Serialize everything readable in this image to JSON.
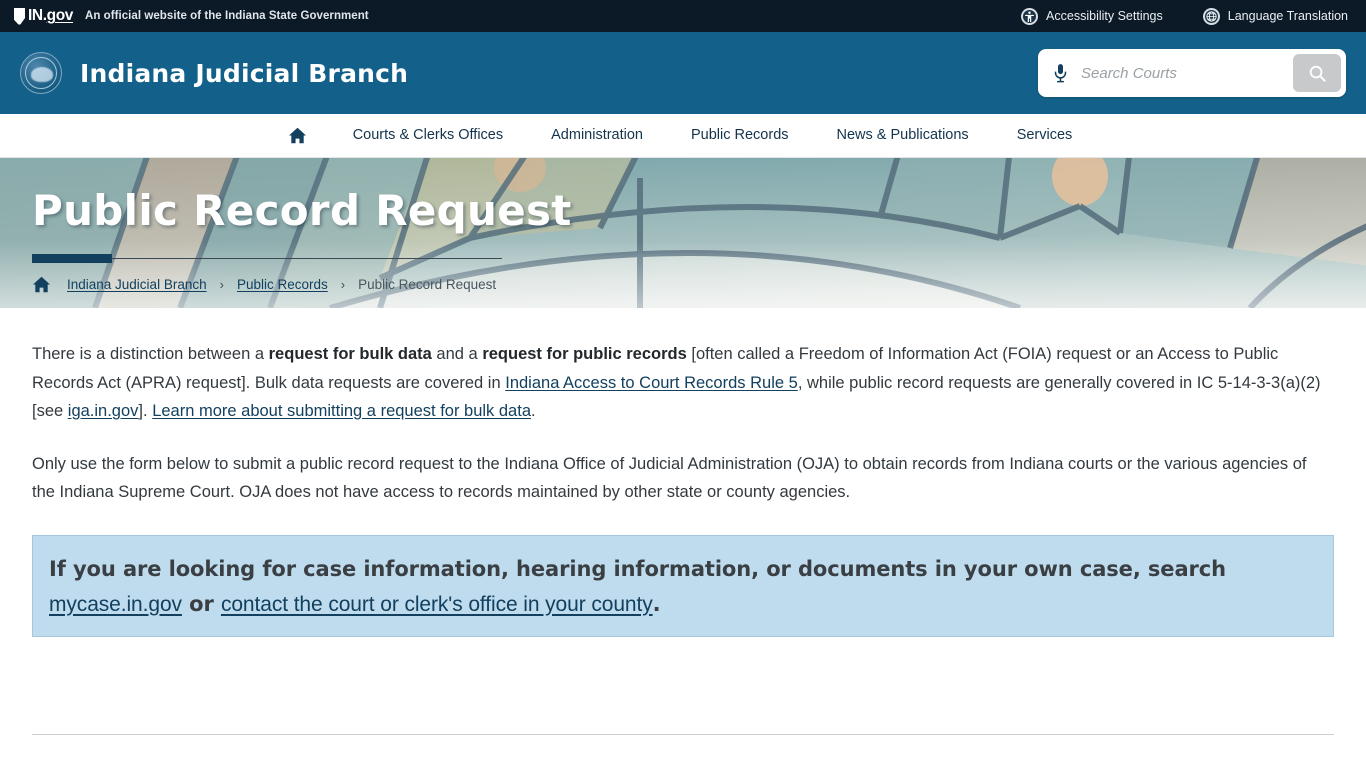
{
  "govbar": {
    "logo_text_in": "IN",
    "logo_text_dot": ".",
    "logo_text_gov": "gov",
    "tagline": "An official website of the Indiana State Government",
    "links": [
      {
        "label": "Accessibility Settings",
        "icon": "accessibility-icon"
      },
      {
        "label": "Language Translation",
        "icon": "globe-icon"
      }
    ]
  },
  "masthead": {
    "site_title": "Indiana Judicial Branch",
    "seal_alt": "indiana-judicial-seal",
    "search": {
      "placeholder": "Search Courts",
      "value": "",
      "mic_icon": "microphone-icon",
      "submit_icon": "search-icon"
    }
  },
  "nav": {
    "home_icon": "home-icon",
    "items": [
      {
        "label": "Courts & Clerks Offices"
      },
      {
        "label": "Administration"
      },
      {
        "label": "Public Records"
      },
      {
        "label": "News & Publications"
      },
      {
        "label": "Services"
      }
    ]
  },
  "hero": {
    "title": "Public Record Request",
    "background": "stained-glass-window",
    "breadcrumb": {
      "home_icon": "home-icon",
      "separator": "›",
      "items": [
        {
          "label": "Indiana Judicial Branch",
          "current": false
        },
        {
          "label": "Public Records",
          "current": false
        },
        {
          "label": "Public Record Request",
          "current": true
        }
      ]
    }
  },
  "content": {
    "paragraph1": {
      "t1": "There is a distinction between a ",
      "b1": "request for bulk data",
      "t2": " and a ",
      "b2": "request for public records",
      "t3": " [often called a Freedom of Information Act (FOIA) request or an Access to Public Records Act (APRA) request]. Bulk data requests are covered in ",
      "link1": "Indiana Access to Court Records Rule 5",
      "t4": ", while public record requests are generally covered in IC 5-14-3-3(a)(2) [see ",
      "link2": "iga.in.gov",
      "t5": "]. ",
      "link3": "Learn more about submitting a request for bulk data",
      "t6": "."
    },
    "paragraph2": "Only use the form below to submit a public record request to the Indiana Office of Judicial Administration (OJA) to obtain records from Indiana courts or the various agencies of the Indiana Supreme Court. OJA does not have access to records maintained by other state or county agencies.",
    "callout": {
      "t1": "If you are looking for case information, hearing information, or documents in your own case, search ",
      "link1": "mycase.in.gov",
      "t2": " or ",
      "link2": "contact the court or clerk's office in your county",
      "t3": "."
    }
  },
  "colors": {
    "govbar_bg": "#0c1a27",
    "header_bg": "#13618a",
    "accent_dark": "#12405e",
    "callout_bg": "#bfdcee",
    "callout_border": "#a4c8dd",
    "link": "#12405e",
    "body_text": "#333a3f"
  }
}
